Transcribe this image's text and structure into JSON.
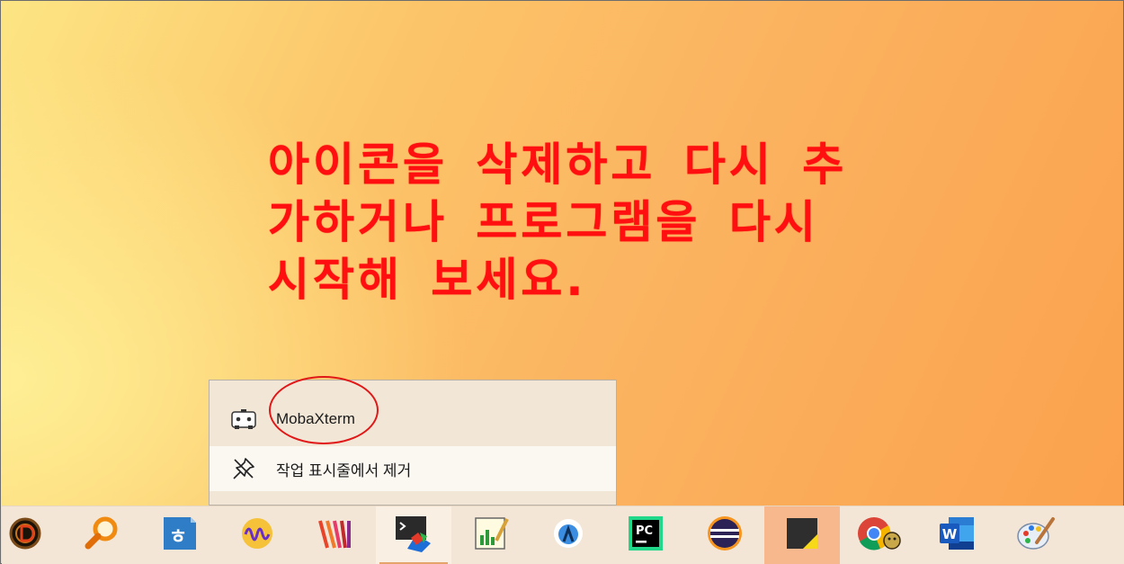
{
  "note": {
    "line1": "아이콘을 삭제하고 다시 추",
    "line2": "가하거나 프로그램을 다시",
    "line3": "시작해 보세요."
  },
  "jumplist": {
    "app_label": "MobaXterm",
    "unpin_label": "작업 표시줄에서 제거",
    "app_icon": "mobaxterm-icon",
    "unpin_icon": "unpin-icon"
  },
  "taskbar": {
    "apps": [
      {
        "name": "diablo-icon"
      },
      {
        "name": "search-app-icon"
      },
      {
        "name": "hwp-icon"
      },
      {
        "name": "wave-app-icon"
      },
      {
        "name": "stripes-app-icon"
      },
      {
        "name": "mobaxterm-taskbar-icon"
      },
      {
        "name": "notepad-chart-icon"
      },
      {
        "name": "android-studio-icon"
      },
      {
        "name": "pycharm-icon"
      },
      {
        "name": "eclipse-icon"
      },
      {
        "name": "sticky-notes-icon"
      },
      {
        "name": "chrome-icon"
      },
      {
        "name": "word-icon"
      },
      {
        "name": "paint-icon"
      }
    ],
    "pycharm_text": "PC",
    "word_text": "W"
  },
  "colors": {
    "note_red": "#ff0f0f",
    "circle_red": "#e01818",
    "taskbar_bg": "#f3e6d6",
    "active_bg": "#f7b88d"
  }
}
